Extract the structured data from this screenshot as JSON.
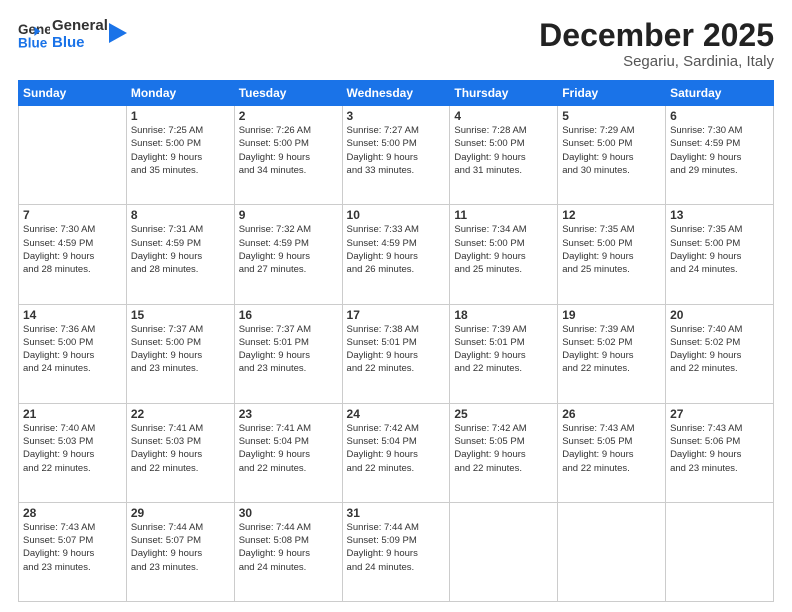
{
  "logo": {
    "line1": "General",
    "line2": "Blue",
    "arrow_color": "#1a73e8"
  },
  "title": "December 2025",
  "subtitle": "Segariu, Sardinia, Italy",
  "days_header": [
    "Sunday",
    "Monday",
    "Tuesday",
    "Wednesday",
    "Thursday",
    "Friday",
    "Saturday"
  ],
  "weeks": [
    [
      {
        "day": "",
        "info": ""
      },
      {
        "day": "1",
        "info": "Sunrise: 7:25 AM\nSunset: 5:00 PM\nDaylight: 9 hours\nand 35 minutes."
      },
      {
        "day": "2",
        "info": "Sunrise: 7:26 AM\nSunset: 5:00 PM\nDaylight: 9 hours\nand 34 minutes."
      },
      {
        "day": "3",
        "info": "Sunrise: 7:27 AM\nSunset: 5:00 PM\nDaylight: 9 hours\nand 33 minutes."
      },
      {
        "day": "4",
        "info": "Sunrise: 7:28 AM\nSunset: 5:00 PM\nDaylight: 9 hours\nand 31 minutes."
      },
      {
        "day": "5",
        "info": "Sunrise: 7:29 AM\nSunset: 5:00 PM\nDaylight: 9 hours\nand 30 minutes."
      },
      {
        "day": "6",
        "info": "Sunrise: 7:30 AM\nSunset: 4:59 PM\nDaylight: 9 hours\nand 29 minutes."
      }
    ],
    [
      {
        "day": "7",
        "info": "Sunrise: 7:30 AM\nSunset: 4:59 PM\nDaylight: 9 hours\nand 28 minutes."
      },
      {
        "day": "8",
        "info": "Sunrise: 7:31 AM\nSunset: 4:59 PM\nDaylight: 9 hours\nand 28 minutes."
      },
      {
        "day": "9",
        "info": "Sunrise: 7:32 AM\nSunset: 4:59 PM\nDaylight: 9 hours\nand 27 minutes."
      },
      {
        "day": "10",
        "info": "Sunrise: 7:33 AM\nSunset: 4:59 PM\nDaylight: 9 hours\nand 26 minutes."
      },
      {
        "day": "11",
        "info": "Sunrise: 7:34 AM\nSunset: 5:00 PM\nDaylight: 9 hours\nand 25 minutes."
      },
      {
        "day": "12",
        "info": "Sunrise: 7:35 AM\nSunset: 5:00 PM\nDaylight: 9 hours\nand 25 minutes."
      },
      {
        "day": "13",
        "info": "Sunrise: 7:35 AM\nSunset: 5:00 PM\nDaylight: 9 hours\nand 24 minutes."
      }
    ],
    [
      {
        "day": "14",
        "info": "Sunrise: 7:36 AM\nSunset: 5:00 PM\nDaylight: 9 hours\nand 24 minutes."
      },
      {
        "day": "15",
        "info": "Sunrise: 7:37 AM\nSunset: 5:00 PM\nDaylight: 9 hours\nand 23 minutes."
      },
      {
        "day": "16",
        "info": "Sunrise: 7:37 AM\nSunset: 5:01 PM\nDaylight: 9 hours\nand 23 minutes."
      },
      {
        "day": "17",
        "info": "Sunrise: 7:38 AM\nSunset: 5:01 PM\nDaylight: 9 hours\nand 22 minutes."
      },
      {
        "day": "18",
        "info": "Sunrise: 7:39 AM\nSunset: 5:01 PM\nDaylight: 9 hours\nand 22 minutes."
      },
      {
        "day": "19",
        "info": "Sunrise: 7:39 AM\nSunset: 5:02 PM\nDaylight: 9 hours\nand 22 minutes."
      },
      {
        "day": "20",
        "info": "Sunrise: 7:40 AM\nSunset: 5:02 PM\nDaylight: 9 hours\nand 22 minutes."
      }
    ],
    [
      {
        "day": "21",
        "info": "Sunrise: 7:40 AM\nSunset: 5:03 PM\nDaylight: 9 hours\nand 22 minutes."
      },
      {
        "day": "22",
        "info": "Sunrise: 7:41 AM\nSunset: 5:03 PM\nDaylight: 9 hours\nand 22 minutes."
      },
      {
        "day": "23",
        "info": "Sunrise: 7:41 AM\nSunset: 5:04 PM\nDaylight: 9 hours\nand 22 minutes."
      },
      {
        "day": "24",
        "info": "Sunrise: 7:42 AM\nSunset: 5:04 PM\nDaylight: 9 hours\nand 22 minutes."
      },
      {
        "day": "25",
        "info": "Sunrise: 7:42 AM\nSunset: 5:05 PM\nDaylight: 9 hours\nand 22 minutes."
      },
      {
        "day": "26",
        "info": "Sunrise: 7:43 AM\nSunset: 5:05 PM\nDaylight: 9 hours\nand 22 minutes."
      },
      {
        "day": "27",
        "info": "Sunrise: 7:43 AM\nSunset: 5:06 PM\nDaylight: 9 hours\nand 23 minutes."
      }
    ],
    [
      {
        "day": "28",
        "info": "Sunrise: 7:43 AM\nSunset: 5:07 PM\nDaylight: 9 hours\nand 23 minutes."
      },
      {
        "day": "29",
        "info": "Sunrise: 7:44 AM\nSunset: 5:07 PM\nDaylight: 9 hours\nand 23 minutes."
      },
      {
        "day": "30",
        "info": "Sunrise: 7:44 AM\nSunset: 5:08 PM\nDaylight: 9 hours\nand 24 minutes."
      },
      {
        "day": "31",
        "info": "Sunrise: 7:44 AM\nSunset: 5:09 PM\nDaylight: 9 hours\nand 24 minutes."
      },
      {
        "day": "",
        "info": ""
      },
      {
        "day": "",
        "info": ""
      },
      {
        "day": "",
        "info": ""
      }
    ]
  ]
}
